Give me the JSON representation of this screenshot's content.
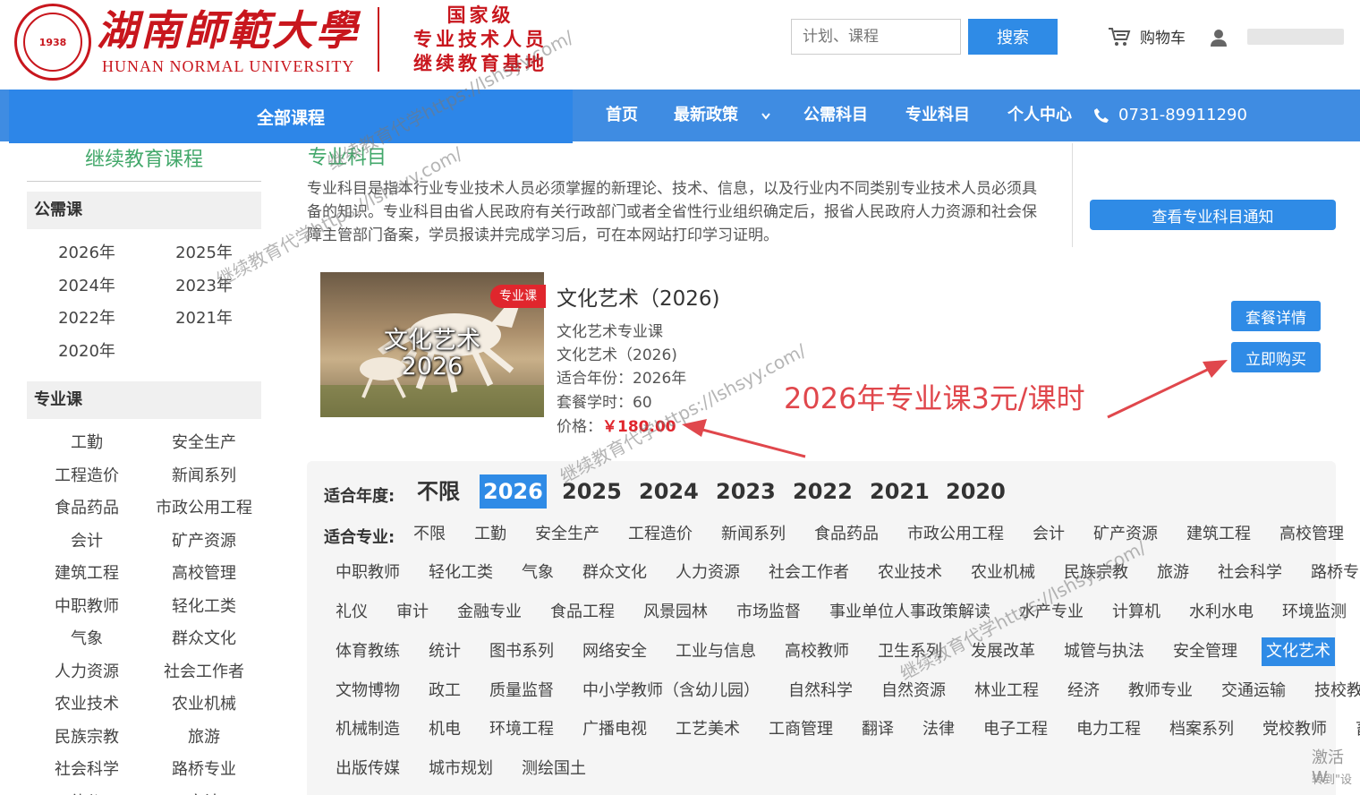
{
  "header": {
    "university_cn": "湖南師範大學",
    "university_en": "HUNAN NORMAL UNIVERSITY",
    "seal_year": "1938",
    "base_lines": [
      "国家级",
      "专业技术人员",
      "继续教育基地"
    ],
    "search_placeholder": "计划、课程",
    "search_button": "搜索",
    "cart_label": "购物车"
  },
  "nav": {
    "all_courses": "全部课程",
    "items": [
      "首页",
      "最新政策",
      "公需科目",
      "专业科目",
      "个人中心"
    ],
    "phone": "0731-89911290"
  },
  "sidebar": {
    "title": "继续教育课程",
    "public_head": "公需课",
    "public_years": [
      "2026年",
      "2025年",
      "2024年",
      "2023年",
      "2022年",
      "2021年",
      "2020年"
    ],
    "major_head": "专业课",
    "major_links": [
      "工勤",
      "安全生产",
      "工程造价",
      "新闻系列",
      "食品药品",
      "市政公用工程",
      "会计",
      "矿产资源",
      "建筑工程",
      "高校管理",
      "中职教师",
      "轻化工类",
      "气象",
      "群众文化",
      "人力资源",
      "社会工作者",
      "农业技术",
      "农业机械",
      "民族宗教",
      "旅游",
      "社会科学",
      "路桥专业",
      "礼仪",
      "审计"
    ]
  },
  "main": {
    "title": "专业科目",
    "description": "专业科目是指本行业专业技术人员必须掌握的新理论、技术、信息，以及行业内不同类别专业技术人员必须具备的知识。专业科目由省人民政府有关行政部门或者全省性行业组织确定后，报省人民政府人力资源和社会保障主管部门备案，学员报读并完成学习后，可在本网站打印学习证明。",
    "notice_button": "查看专业科目通知"
  },
  "course": {
    "image_line1": "文化艺术",
    "image_line2": "2026",
    "badge": "专业课",
    "title": "文化艺术（2026)",
    "line1": "文化艺术专业课",
    "line2": "文化艺术（2026)",
    "year_label": "适合年份：",
    "year_value": "2026年",
    "hours_label": "套餐学时：",
    "hours_value": "60",
    "price_label": "价格：",
    "price_value": "￥180.00",
    "detail_button": "套餐详情",
    "buy_button": "立即购买",
    "annotation": "2026年专业课3元/课时"
  },
  "filter": {
    "year_label": "适合年度:",
    "years": [
      "不限",
      "2026",
      "2025",
      "2024",
      "2023",
      "2022",
      "2021",
      "2020"
    ],
    "active_year": "2026",
    "major_label": "适合专业:",
    "rows": [
      [
        "不限",
        "工勤",
        "安全生产",
        "工程造价",
        "新闻系列",
        "食品药品",
        "市政公用工程",
        "会计",
        "矿产资源",
        "建筑工程",
        "高校管理"
      ],
      [
        "中职教师",
        "轻化工类",
        "气象",
        "群众文化",
        "人力资源",
        "社会工作者",
        "农业技术",
        "农业机械",
        "民族宗教",
        "旅游",
        "社会科学",
        "路桥专业"
      ],
      [
        "礼仪",
        "审计",
        "金融专业",
        "食品工程",
        "风景园林",
        "市场监督",
        "事业单位人事政策解读",
        "水产专业",
        "计算机",
        "水利水电",
        "环境监测"
      ],
      [
        "体育教练",
        "统计",
        "图书系列",
        "网络安全",
        "工业与信息",
        "高校教师",
        "卫生系列",
        "发展改革",
        "城管与执法",
        "安全管理",
        "文化艺术"
      ],
      [
        "文物博物",
        "政工",
        "质量监督",
        "中小学教师（含幼儿园）",
        "自然科学",
        "自然资源",
        "林业工程",
        "经济",
        "教师专业",
        "交通运输",
        "技校教师"
      ],
      [
        "机械制造",
        "机电",
        "环境工程",
        "广播电视",
        "工艺美术",
        "工商管理",
        "翻译",
        "法律",
        "电子工程",
        "电力工程",
        "档案系列",
        "党校教师",
        "畜牧"
      ],
      [
        "出版传媒",
        "城市规划",
        "测绘国土"
      ]
    ],
    "active_major": "文化艺术"
  },
  "watermarks": [
    "继续教育代学https://lshsyy.com/",
    "继续教育代学https://lshsyy.com/",
    "继续教育代学https://lshsyy.com/",
    "继续教育代学https://lshsyy.com/"
  ],
  "os_overlay": {
    "line1": "激活 W",
    "line2": "转到\"设"
  }
}
